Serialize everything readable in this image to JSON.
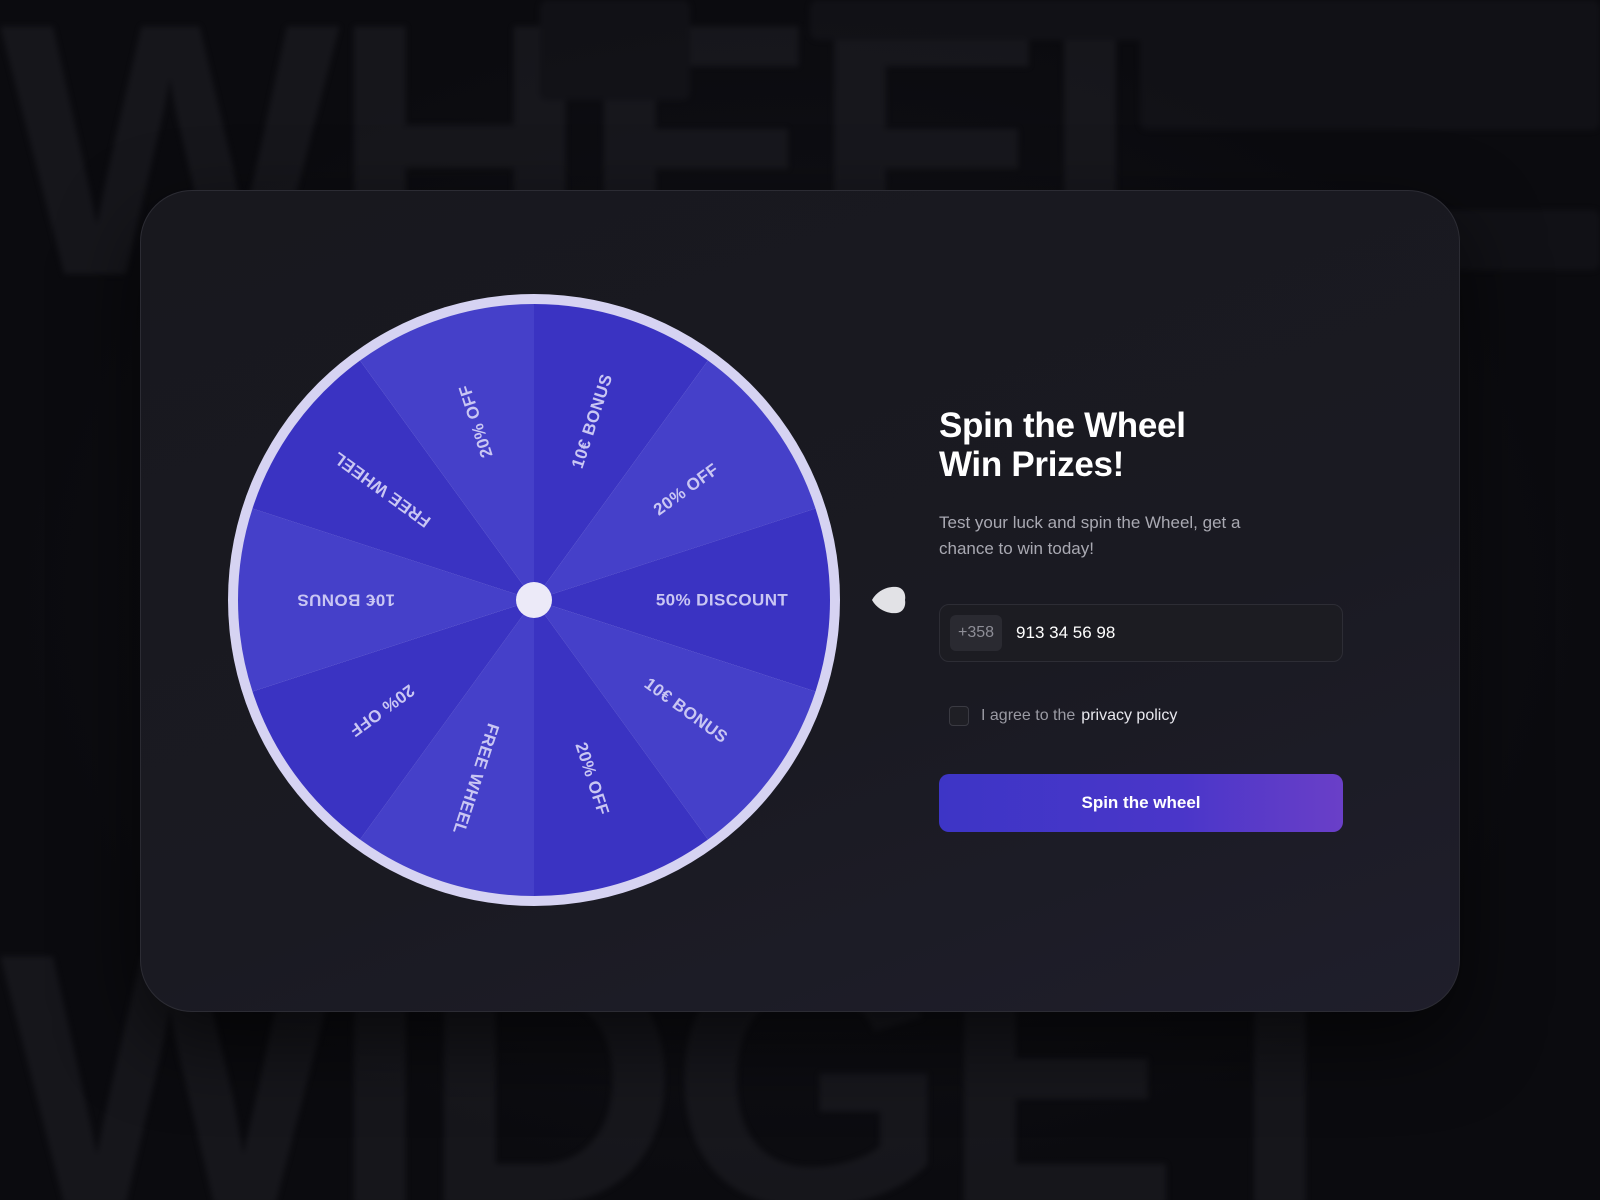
{
  "background": {
    "word_top": "WHEEL",
    "word_bottom": "WIDGET"
  },
  "wheel": {
    "segments": [
      "10€ BONUS",
      "20% OFF",
      "50% DISCOUNT",
      "10€ BONUS",
      "20% OFF",
      "FREE WHEEL",
      "20% OFF",
      "10€ BONUS",
      "FREE WHEEL",
      "20% OFF"
    ],
    "colors": {
      "rim": "#d6d3f2",
      "segment_dark": "#3a33c2",
      "segment_light": "#4540c9",
      "label": "#c9c6f3",
      "hub": "#eceaf8",
      "pointer": "#e2e2e6"
    }
  },
  "form": {
    "title_line1": "Spin the Wheel",
    "title_line2": "Win Prizes!",
    "description": "Test your luck and spin the Wheel, get a chance to win today!",
    "country_code": "+358",
    "phone_value": "913 34 56 98",
    "agree_text": "I agree to the",
    "policy_link": "privacy policy",
    "checkbox_checked": false,
    "button_label": "Spin the wheel"
  }
}
